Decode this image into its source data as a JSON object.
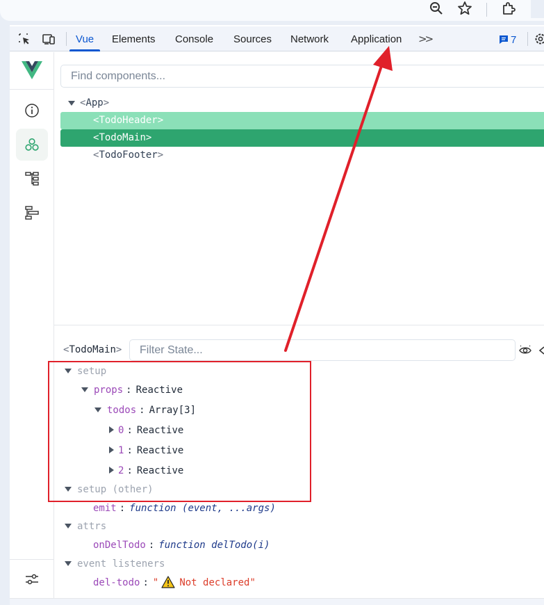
{
  "devtools": {
    "tabs": [
      "Vue",
      "Elements",
      "Console",
      "Sources",
      "Network",
      "Application"
    ],
    "active_tab": "Vue",
    "more_tabs": ">>",
    "issues_count": "7"
  },
  "components": {
    "search_placeholder": "Find components...",
    "tree": [
      {
        "name": "App",
        "state": "normal"
      },
      {
        "name": "TodoHeader",
        "state": "hover"
      },
      {
        "name": "TodoMain",
        "state": "selected"
      },
      {
        "name": "TodoFooter",
        "state": "normal"
      }
    ]
  },
  "inspector": {
    "component": "TodoMain",
    "filter_placeholder": "Filter State...",
    "setup_label": "setup",
    "props_key": "props",
    "props_value": "Reactive",
    "todos_key": "todos",
    "todos_value": "Array[3]",
    "items": [
      {
        "key": "0",
        "value": "Reactive"
      },
      {
        "key": "1",
        "value": "Reactive"
      },
      {
        "key": "2",
        "value": "Reactive"
      }
    ],
    "setup_other_label": "setup (other)",
    "emit_key": "emit",
    "emit_value": "function (event, ...args)",
    "attrs_label": "attrs",
    "ondeltodo_key": "onDelTodo",
    "ondeltodo_value": "function delTodo(i)",
    "listeners_label": "event listeners",
    "deltodo_key": "del-todo",
    "deltodo_quote_open": "\"",
    "deltodo_value": "Not declared",
    "deltodo_quote_close": "\""
  },
  "colors": {
    "accent_blue": "#0b57d0",
    "vue_green": "#42b883",
    "selected_row": "#2ea56f",
    "hover_row": "#8be0b8",
    "annotation_red": "#e0202a"
  },
  "icons": [
    "zoom-icon",
    "star-icon",
    "extensions-icon",
    "inspect-icon",
    "device-toggle-icon",
    "issues-icon",
    "settings-icon",
    "vue-logo",
    "info-icon",
    "components-icon",
    "tree-icon",
    "timeline-icon",
    "eye-icon",
    "settings-sliders-icon",
    "warning-icon"
  ]
}
